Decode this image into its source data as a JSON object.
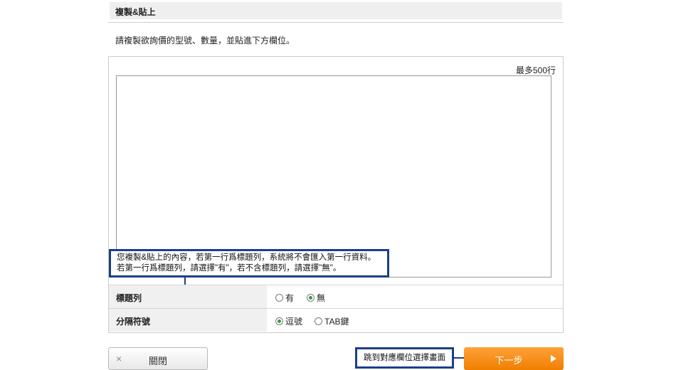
{
  "section": {
    "title": "複製&貼上",
    "instruction": "請複製欲詢價的型號、數量，並貼進下方欄位。"
  },
  "paste": {
    "max_lines": "最多500行",
    "placeholder": ""
  },
  "callout": {
    "line1": "您複製&貼上的內容，若第一行爲標題列，系統將不會匯入第一行資料。",
    "line2": "若第一行爲標題列，請選擇\"有\"，若不含標題列，請選擇\"無\"。"
  },
  "options": {
    "header_row": {
      "label": "標題列",
      "choices": [
        {
          "label": "有",
          "checked": false
        },
        {
          "label": "無",
          "checked": true
        }
      ]
    },
    "delimiter": {
      "label": "分隔符號",
      "choices": [
        {
          "label": "逗號",
          "checked": true
        },
        {
          "label": "TAB鍵",
          "checked": false
        }
      ]
    }
  },
  "buttons": {
    "close": "關閉",
    "close_icon": "×",
    "next": "下一步"
  },
  "hint": "跳到對應欄位選擇畫面",
  "colors": {
    "accent_orange": "#f68b1f",
    "callout_blue": "#1a3f8a",
    "radio_green": "#3a9a3a"
  }
}
